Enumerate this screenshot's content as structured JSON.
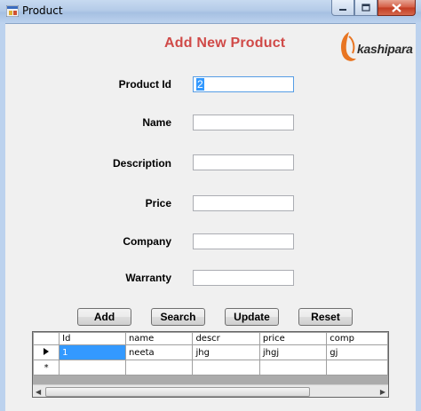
{
  "window": {
    "title": "Product",
    "icons": {
      "app": "form-app-icon",
      "minimize": "minimize-icon",
      "maximize": "maximize-icon",
      "close": "close-icon"
    }
  },
  "form": {
    "heading": "Add New Product",
    "logo_text": "kashipara",
    "fields": [
      {
        "label": "Product Id",
        "value": "2"
      },
      {
        "label": "Name",
        "value": ""
      },
      {
        "label": "Description",
        "value": ""
      },
      {
        "label": "Price",
        "value": ""
      },
      {
        "label": "Company",
        "value": ""
      },
      {
        "label": "Warranty",
        "value": ""
      }
    ]
  },
  "buttons": {
    "add": "Add",
    "search": "Search",
    "update": "Update",
    "reset": "Reset"
  },
  "grid": {
    "columns": [
      "Id",
      "name",
      "descr",
      "price",
      "comp"
    ],
    "rows": [
      [
        "1",
        "neeta",
        "jhg",
        "jhgj",
        "gj"
      ]
    ],
    "new_row_marker": "*"
  },
  "colors": {
    "heading": "#d04a48",
    "selection": "#3399ff",
    "logo_accent": "#e87522"
  }
}
